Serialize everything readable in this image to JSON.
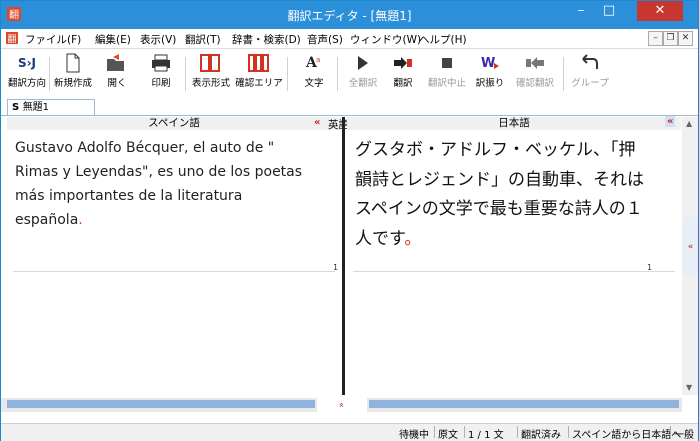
{
  "window": {
    "title": "翻訳エディタ - [無題1]"
  },
  "menu": {
    "items": [
      "ファイル(F)",
      "編集(E)",
      "表示(V)",
      "翻訳(T)",
      "辞書・検索(D)",
      "音声(S)",
      "ウィンドウ(W)",
      "ヘルプ(H)"
    ]
  },
  "toolbar": {
    "direction_label": "翻訳方向",
    "direction_icon_text": "S›J",
    "new_label": "新規作成",
    "open_label": "開く",
    "print_label": "印刷",
    "display_label": "表示形式",
    "confirm_area_label": "確認エリア",
    "text_label": "文字",
    "translate_all_label": "全翻訳",
    "translate_label": "翻訳",
    "stop_label": "翻訳中止",
    "assign_label": "訳振り",
    "confirm_translate_label": "確認翻訳",
    "group_label": "グループ"
  },
  "tabs": {
    "doc_tab": "無題1",
    "doc_tab_prefix": "S"
  },
  "panes": {
    "source_header": "スペイン語",
    "swap_left": "«",
    "middle_label": "英語",
    "swap_right": "»",
    "target_header": "日本語",
    "collapse": "«",
    "source_text_main": "Gustavo Adolfo Bécquer, el auto de \" Rimas y Leyendas\", es uno de los poetas más importantes de la literatura española",
    "source_text_end": ".",
    "target_text_main": "グスタボ・アドルフ・ベッケル、「押韻詩とレジェンド」の自動車、それはスペインの文学で最も重要な詩人の１人です",
    "target_text_end": "。",
    "source_line_num": "1",
    "target_line_num": "1"
  },
  "bottom": {
    "center_arrow": "»",
    "side_arrow": "«"
  },
  "status": {
    "state": "待機中",
    "mode": "原文",
    "sentence_count": "1 / 1 文",
    "translated": "翻訳済み",
    "direction": "スペイン語から日本語へ",
    "field": "一般"
  },
  "colors": {
    "titlebar": "#2b8fd9",
    "close": "#c7372f",
    "accent_red": "#c0261f"
  }
}
